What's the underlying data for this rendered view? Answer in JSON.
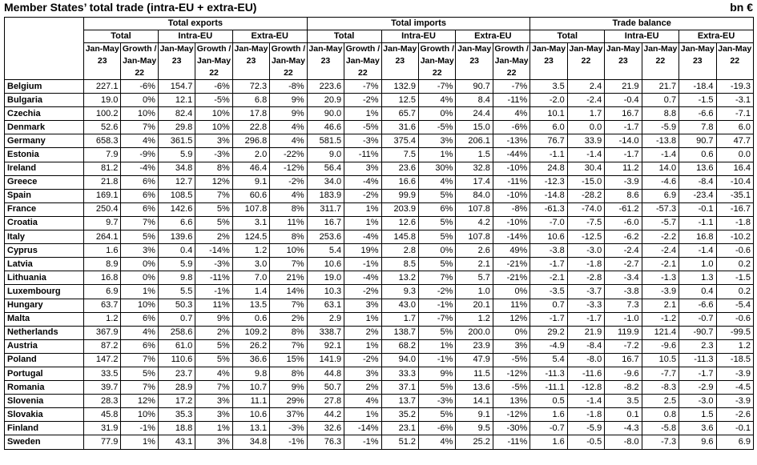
{
  "title": "Member States’ total trade (intra-EU + extra-EU)",
  "unit": "bn €",
  "groups": [
    "Total exports",
    "Total imports",
    "Trade balance"
  ],
  "subgroups": [
    "Total",
    "Intra-EU",
    "Extra-EU"
  ],
  "col_labels": {
    "jan23": "Jan-May 23",
    "growth": "Growth / Jan-May 22",
    "jan22": "Jan-May 22"
  },
  "rows": [
    [
      "Belgium",
      "227.1",
      "-6%",
      "154.7",
      "-6%",
      "72.3",
      "-8%",
      "223.6",
      "-7%",
      "132.9",
      "-7%",
      "90.7",
      "-7%",
      "3.5",
      "2.4",
      "21.9",
      "21.7",
      "-18.4",
      "-19.3"
    ],
    [
      "Bulgaria",
      "19.0",
      "0%",
      "12.1",
      "-5%",
      "6.8",
      "9%",
      "20.9",
      "-2%",
      "12.5",
      "4%",
      "8.4",
      "-11%",
      "-2.0",
      "-2.4",
      "-0.4",
      "0.7",
      "-1.5",
      "-3.1"
    ],
    [
      "Czechia",
      "100.2",
      "10%",
      "82.4",
      "10%",
      "17.8",
      "9%",
      "90.0",
      "1%",
      "65.7",
      "0%",
      "24.4",
      "4%",
      "10.1",
      "1.7",
      "16.7",
      "8.8",
      "-6.6",
      "-7.1"
    ],
    [
      "Denmark",
      "52.6",
      "7%",
      "29.8",
      "10%",
      "22.8",
      "4%",
      "46.6",
      "-5%",
      "31.6",
      "-5%",
      "15.0",
      "-6%",
      "6.0",
      "0.0",
      "-1.7",
      "-5.9",
      "7.8",
      "6.0"
    ],
    [
      "Germany",
      "658.3",
      "4%",
      "361.5",
      "3%",
      "296.8",
      "4%",
      "581.5",
      "-3%",
      "375.4",
      "3%",
      "206.1",
      "-13%",
      "76.7",
      "33.9",
      "-14.0",
      "-13.8",
      "90.7",
      "47.7"
    ],
    [
      "Estonia",
      "7.9",
      "-9%",
      "5.9",
      "-3%",
      "2.0",
      "-22%",
      "9.0",
      "-11%",
      "7.5",
      "1%",
      "1.5",
      "-44%",
      "-1.1",
      "-1.4",
      "-1.7",
      "-1.4",
      "0.6",
      "0.0"
    ],
    [
      "Ireland",
      "81.2",
      "-4%",
      "34.8",
      "8%",
      "46.4",
      "-12%",
      "56.4",
      "3%",
      "23.6",
      "30%",
      "32.8",
      "-10%",
      "24.8",
      "30.4",
      "11.2",
      "14.0",
      "13.6",
      "16.4"
    ],
    [
      "Greece",
      "21.8",
      "6%",
      "12.7",
      "12%",
      "9.1",
      "-2%",
      "34.0",
      "-4%",
      "16.6",
      "4%",
      "17.4",
      "-11%",
      "-12.3",
      "-15.0",
      "-3.9",
      "-4.6",
      "-8.4",
      "-10.4"
    ],
    [
      "Spain",
      "169.1",
      "6%",
      "108.5",
      "7%",
      "60.6",
      "4%",
      "183.9",
      "-2%",
      "99.9",
      "5%",
      "84.0",
      "-10%",
      "-14.8",
      "-28.2",
      "8.6",
      "6.9",
      "-23.4",
      "-35.1"
    ],
    [
      "France",
      "250.4",
      "6%",
      "142.6",
      "5%",
      "107.8",
      "8%",
      "311.7",
      "1%",
      "203.9",
      "6%",
      "107.8",
      "-8%",
      "-61.3",
      "-74.0",
      "-61.2",
      "-57.3",
      "-0.1",
      "-16.7"
    ],
    [
      "Croatia",
      "9.7",
      "7%",
      "6.6",
      "5%",
      "3.1",
      "11%",
      "16.7",
      "1%",
      "12.6",
      "5%",
      "4.2",
      "-10%",
      "-7.0",
      "-7.5",
      "-6.0",
      "-5.7",
      "-1.1",
      "-1.8"
    ],
    [
      "Italy",
      "264.1",
      "5%",
      "139.6",
      "2%",
      "124.5",
      "8%",
      "253.6",
      "-4%",
      "145.8",
      "5%",
      "107.8",
      "-14%",
      "10.6",
      "-12.5",
      "-6.2",
      "-2.2",
      "16.8",
      "-10.2"
    ],
    [
      "Cyprus",
      "1.6",
      "3%",
      "0.4",
      "-14%",
      "1.2",
      "10%",
      "5.4",
      "19%",
      "2.8",
      "0%",
      "2.6",
      "49%",
      "-3.8",
      "-3.0",
      "-2.4",
      "-2.4",
      "-1.4",
      "-0.6"
    ],
    [
      "Latvia",
      "8.9",
      "0%",
      "5.9",
      "-3%",
      "3.0",
      "7%",
      "10.6",
      "-1%",
      "8.5",
      "5%",
      "2.1",
      "-21%",
      "-1.7",
      "-1.8",
      "-2.7",
      "-2.1",
      "1.0",
      "0.2"
    ],
    [
      "Lithuania",
      "16.8",
      "0%",
      "9.8",
      "-11%",
      "7.0",
      "21%",
      "19.0",
      "-4%",
      "13.2",
      "7%",
      "5.7",
      "-21%",
      "-2.1",
      "-2.8",
      "-3.4",
      "-1.3",
      "1.3",
      "-1.5"
    ],
    [
      "Luxembourg",
      "6.9",
      "1%",
      "5.5",
      "-1%",
      "1.4",
      "14%",
      "10.3",
      "-2%",
      "9.3",
      "-2%",
      "1.0",
      "0%",
      "-3.5",
      "-3.7",
      "-3.8",
      "-3.9",
      "0.4",
      "0.2"
    ],
    [
      "Hungary",
      "63.7",
      "10%",
      "50.3",
      "11%",
      "13.5",
      "7%",
      "63.1",
      "3%",
      "43.0",
      "-1%",
      "20.1",
      "11%",
      "0.7",
      "-3.3",
      "7.3",
      "2.1",
      "-6.6",
      "-5.4"
    ],
    [
      "Malta",
      "1.2",
      "6%",
      "0.7",
      "9%",
      "0.6",
      "2%",
      "2.9",
      "1%",
      "1.7",
      "-7%",
      "1.2",
      "12%",
      "-1.7",
      "-1.7",
      "-1.0",
      "-1.2",
      "-0.7",
      "-0.6"
    ],
    [
      "Netherlands",
      "367.9",
      "4%",
      "258.6",
      "2%",
      "109.2",
      "8%",
      "338.7",
      "2%",
      "138.7",
      "5%",
      "200.0",
      "0%",
      "29.2",
      "21.9",
      "119.9",
      "121.4",
      "-90.7",
      "-99.5"
    ],
    [
      "Austria",
      "87.2",
      "6%",
      "61.0",
      "5%",
      "26.2",
      "7%",
      "92.1",
      "1%",
      "68.2",
      "1%",
      "23.9",
      "3%",
      "-4.9",
      "-8.4",
      "-7.2",
      "-9.6",
      "2.3",
      "1.2"
    ],
    [
      "Poland",
      "147.2",
      "7%",
      "110.6",
      "5%",
      "36.6",
      "15%",
      "141.9",
      "-2%",
      "94.0",
      "-1%",
      "47.9",
      "-5%",
      "5.4",
      "-8.0",
      "16.7",
      "10.5",
      "-11.3",
      "-18.5"
    ],
    [
      "Portugal",
      "33.5",
      "5%",
      "23.7",
      "4%",
      "9.8",
      "8%",
      "44.8",
      "3%",
      "33.3",
      "9%",
      "11.5",
      "-12%",
      "-11.3",
      "-11.6",
      "-9.6",
      "-7.7",
      "-1.7",
      "-3.9"
    ],
    [
      "Romania",
      "39.7",
      "7%",
      "28.9",
      "7%",
      "10.7",
      "9%",
      "50.7",
      "2%",
      "37.1",
      "5%",
      "13.6",
      "-5%",
      "-11.1",
      "-12.8",
      "-8.2",
      "-8.3",
      "-2.9",
      "-4.5"
    ],
    [
      "Slovenia",
      "28.3",
      "12%",
      "17.2",
      "3%",
      "11.1",
      "29%",
      "27.8",
      "4%",
      "13.7",
      "-3%",
      "14.1",
      "13%",
      "0.5",
      "-1.4",
      "3.5",
      "2.5",
      "-3.0",
      "-3.9"
    ],
    [
      "Slovakia",
      "45.8",
      "10%",
      "35.3",
      "3%",
      "10.6",
      "37%",
      "44.2",
      "1%",
      "35.2",
      "5%",
      "9.1",
      "-12%",
      "1.6",
      "-1.8",
      "0.1",
      "0.8",
      "1.5",
      "-2.6"
    ],
    [
      "Finland",
      "31.9",
      "-1%",
      "18.8",
      "1%",
      "13.1",
      "-3%",
      "32.6",
      "-14%",
      "23.1",
      "-6%",
      "9.5",
      "-30%",
      "-0.7",
      "-5.9",
      "-4.3",
      "-5.8",
      "3.6",
      "-0.1"
    ],
    [
      "Sweden",
      "77.9",
      "1%",
      "43.1",
      "3%",
      "34.8",
      "-1%",
      "76.3",
      "-1%",
      "51.2",
      "4%",
      "25.2",
      "-11%",
      "1.6",
      "-0.5",
      "-8.0",
      "-7.3",
      "9.6",
      "6.9"
    ]
  ]
}
